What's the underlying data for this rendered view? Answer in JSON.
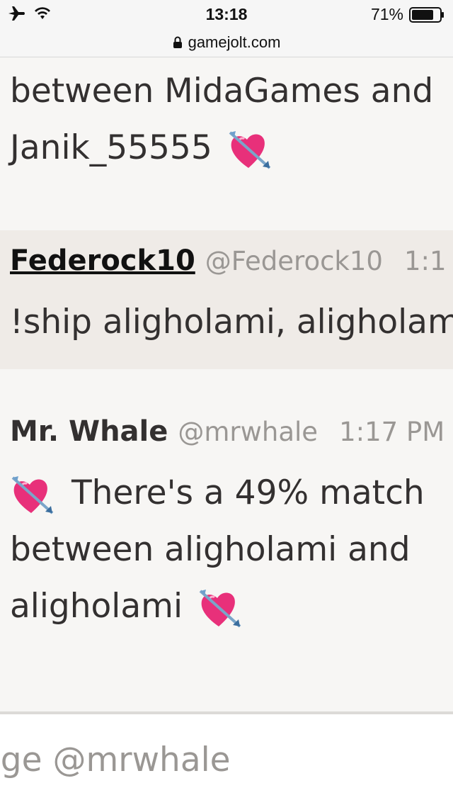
{
  "status": {
    "time": "13:18",
    "battery": "71%",
    "icons": [
      "airplane-icon",
      "wifi-icon",
      "battery-icon"
    ]
  },
  "browser": {
    "url": "gamejolt.com",
    "lock_icon": "lock-icon"
  },
  "messages": [
    {
      "lines": [
        "between MidaGames and",
        "Janik_55555"
      ],
      "emoji": "heart-with-arrow"
    },
    {
      "author": "Federock10",
      "handle": "@Federock10",
      "time": "1:1",
      "text": "!ship aligholami, aligholam"
    },
    {
      "author": "Mr. Whale",
      "handle": "@mrwhale",
      "time": "1:17 PM",
      "lines": [
        "There's a 49% match",
        "between aligholami and",
        "aligholami"
      ],
      "emoji": "heart-with-arrow"
    }
  ],
  "composer": {
    "placeholder": "age @mrwhale"
  },
  "colors": {
    "background": "#f7f6f4",
    "highlight": "#efebe7",
    "text": "#333030",
    "muted": "#9a9794"
  }
}
